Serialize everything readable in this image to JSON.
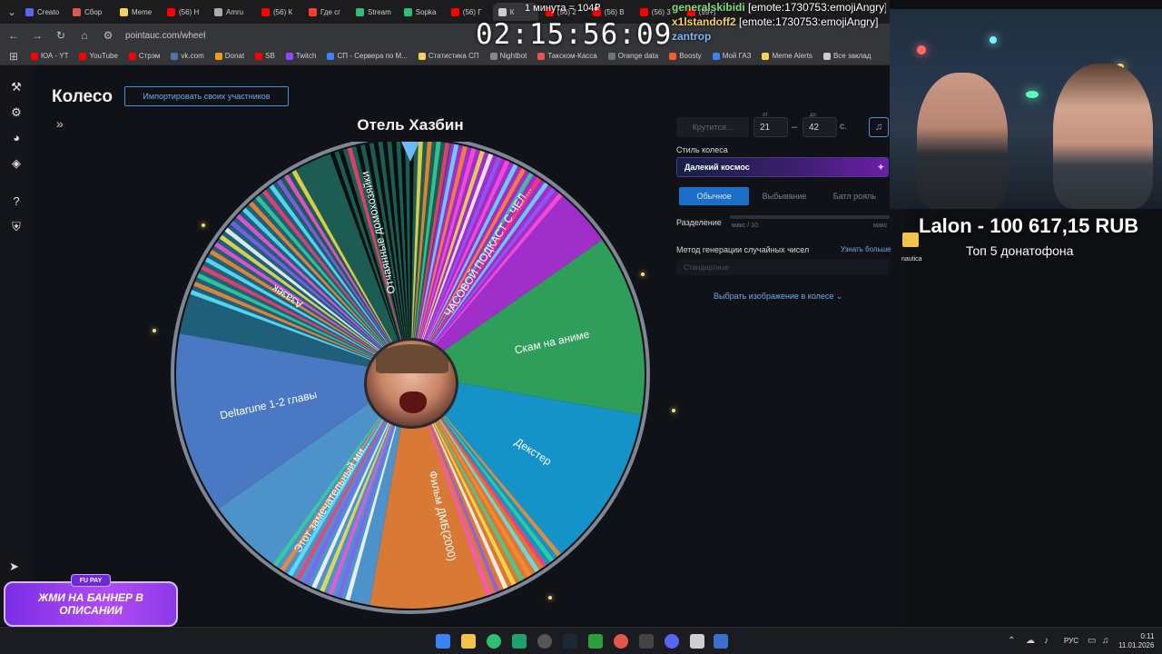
{
  "browser": {
    "tabs": [
      {
        "label": "Creato",
        "color": "#5865f2"
      },
      {
        "label": "Сбор",
        "color": "#e2574c"
      },
      {
        "label": "Meme",
        "color": "#f3d35a"
      },
      {
        "label": "(56) Н",
        "color": "#ff0000"
      },
      {
        "label": "Amru",
        "color": "#aaaaaa"
      },
      {
        "label": "(56) К",
        "color": "#ff0000"
      },
      {
        "label": "Где сг",
        "color": "#ff3b30"
      },
      {
        "label": "Stream",
        "color": "#2fbf71"
      },
      {
        "label": "Sopka",
        "color": "#2fbf71"
      },
      {
        "label": "(56) Г",
        "color": "#ff0000"
      },
      {
        "label": "К",
        "color": "#cccccc"
      },
      {
        "label": "(56) 2",
        "color": "#ff0000"
      },
      {
        "label": "(56) В",
        "color": "#ff0000"
      },
      {
        "label": "(56) 3",
        "color": "#ff0000"
      },
      {
        "label": "(99+)",
        "color": "#ff0000"
      }
    ],
    "url": "pointauc.com/wheel",
    "bookmarks": [
      {
        "label": "ЮА - YT",
        "color": "#ff0000"
      },
      {
        "label": "YouTube",
        "color": "#ff0000"
      },
      {
        "label": "Стрэм",
        "color": "#ff0000"
      },
      {
        "label": "vk.com",
        "color": "#4a76a8"
      },
      {
        "label": "Donat",
        "color": "#f39c12"
      },
      {
        "label": "SB",
        "color": "#ff0000"
      },
      {
        "label": "Twitch",
        "color": "#9146ff"
      },
      {
        "label": "СП - Сервера по М...",
        "color": "#3b82f6"
      },
      {
        "label": "Статистика СП",
        "color": "#f3d35a"
      },
      {
        "label": "Nightbot",
        "color": "#888888"
      },
      {
        "label": "Такском-Касса",
        "color": "#e2574c"
      },
      {
        "label": "Orange data",
        "color": "#6b7280"
      },
      {
        "label": "Boosty",
        "color": "#f15f2c"
      },
      {
        "label": "Мой ГАЗ",
        "color": "#3b82f6"
      },
      {
        "label": "Meme Alerts",
        "color": "#f3d35a"
      },
      {
        "label": "Все заклад",
        "color": "#cccccc"
      }
    ]
  },
  "overlay": {
    "minute_counter": "1 минута = 104₽",
    "timer": "02:15:56:09",
    "chat": [
      {
        "user": "generalskibidi",
        "text": "[emote:1730753:emojiAngry]",
        "style": "chat-user"
      },
      {
        "user": "x1lstandoff2",
        "text": "[emote:1730753:emojiAngry]",
        "style": "chat-gold"
      },
      {
        "user": "zantrop",
        "text": "",
        "style": "chat-blue"
      }
    ],
    "donor_line": "Lalon - 100 617,15 RUB",
    "donor_sub": "Топ  5 донатофона",
    "folder_label": "nautica",
    "banner_text": "ЖМИ НА БАННЕР В ОПИСАНИИ",
    "banner_logo": "FU PAY"
  },
  "app": {
    "title": "Колесо",
    "import_button": "Импортировать своих участников",
    "wheel_title": "Отель Хазбин",
    "spin_button": "Крутится...",
    "range_from_caption": "от",
    "range_from": "21",
    "range_to_caption": "до",
    "range_to": "42",
    "seconds_label": "с.",
    "style_label": "Стиль колеса",
    "style_value": "Далекий космос",
    "modes": [
      "Обычное",
      "Выбывание",
      "Батл рояль"
    ],
    "active_mode": 0,
    "split_label": "Разделение",
    "split_min_label": "макс / 10",
    "split_max_label": "макс",
    "rng_label": "Метод генерации случайных чисел",
    "rng_more": "Узнать больше",
    "rng_value": "Стандартные",
    "image_link": "Выбрать изображение в колесе"
  },
  "wheel": {
    "segments": [
      {
        "label": "Азазек",
        "color": "#1f5f7a"
      },
      {
        "label": "Отчаянные домохозяйки",
        "color": "#1d5c52"
      },
      {
        "label": "ЧАСОВОЙ ПОДКАСТ С ЧЕЛ...",
        "color": "#a02ec9"
      },
      {
        "label": "Скам на аниме",
        "color": "#2e9e5a"
      },
      {
        "label": "Декстер",
        "color": "#1592c8"
      },
      {
        "label": "Фильм ДМБ(2000)",
        "color": "#d87a36"
      },
      {
        "label": "Этот замечательный ми...",
        "color": "#4d93c9"
      },
      {
        "label": "Deltarune 1-2 главы",
        "color": "#4b78c2"
      }
    ]
  },
  "taskbar": {
    "lang": "РУС",
    "time": "0:11",
    "date": "11.01.2026"
  }
}
